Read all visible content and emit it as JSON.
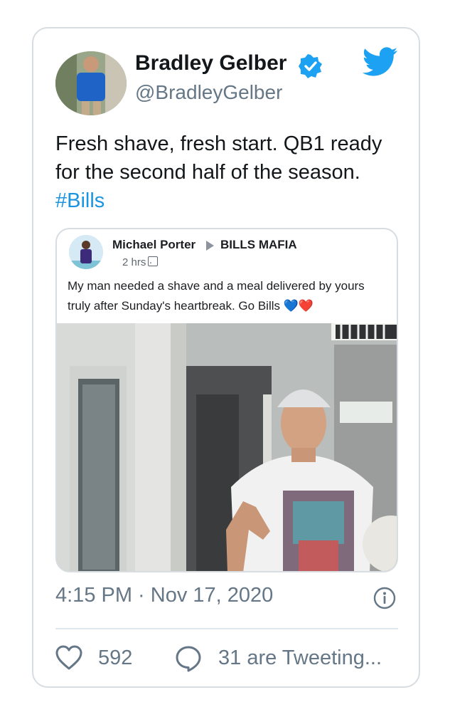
{
  "tweet": {
    "author_name": "Bradley Gelber",
    "author_handle": "@BradleyGelber",
    "text_main": "Fresh shave, fresh start. QB1 ready for the second half of the season. ",
    "hashtag": "#Bills",
    "timestamp": "4:15 PM · Nov 17, 2020",
    "likes": "592",
    "tweeting": "31 are Tweeting...",
    "icons": {
      "verified": "verified-badge-icon",
      "brand": "twitter-bird-icon",
      "info": "info-icon",
      "like": "heart-icon",
      "reply": "reply-bubble-icon"
    },
    "colors": {
      "accent": "#1da1f2",
      "text": "#14171a",
      "muted": "#657786",
      "border": "#d8dde1"
    }
  },
  "quoted_post": {
    "author": "Michael Porter",
    "group": "BILLS MAFIA",
    "time": "2 hrs ·",
    "text": "My man needed a shave and a meal delivered by yours truly after Sunday's heartbreak. Go Bills 💙❤️"
  }
}
